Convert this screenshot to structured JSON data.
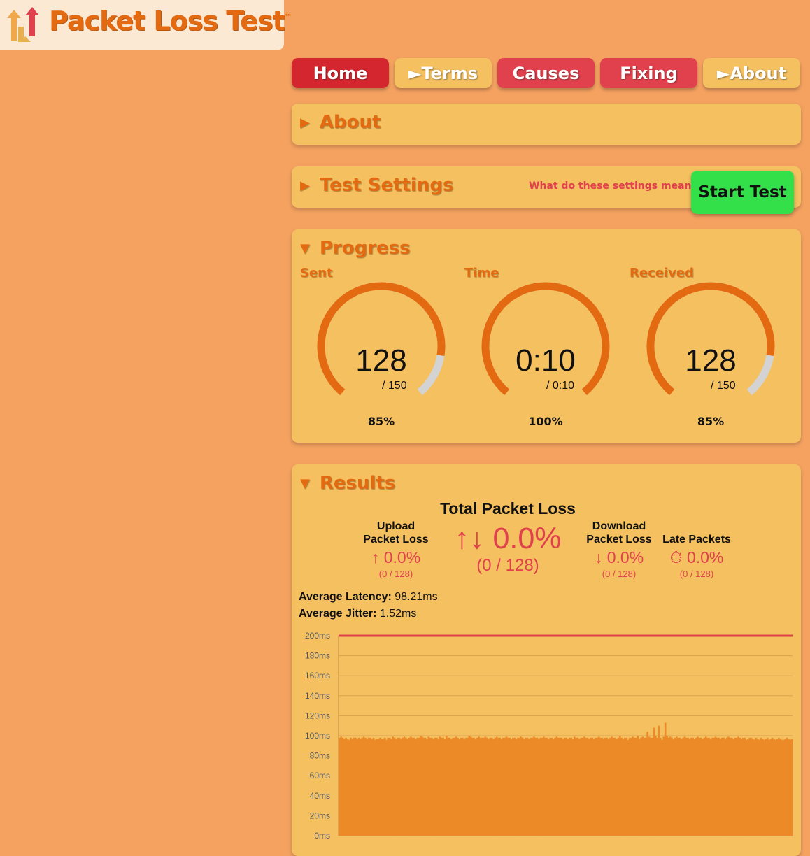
{
  "logo": {
    "title": "Packet Loss Test",
    "trademark": "™"
  },
  "nav": {
    "home": "Home",
    "terms": "►Terms",
    "causes": "Causes",
    "fixing": "Fixing",
    "about": "►About"
  },
  "about_panel": {
    "title": "About"
  },
  "settings_panel": {
    "title": "Test Settings",
    "help_link": "What do these settings mean?",
    "start_button": "Start Test"
  },
  "progress_panel": {
    "title": "Progress",
    "gauges": [
      {
        "label": "Sent",
        "value": "128",
        "total": "/ 150",
        "percent": "85%",
        "fraction": 0.853
      },
      {
        "label": "Time",
        "value": "0:10",
        "total": "/ 0:10",
        "percent": "100%",
        "fraction": 1.0
      },
      {
        "label": "Received",
        "value": "128",
        "total": "/ 150",
        "percent": "85%",
        "fraction": 0.853
      }
    ]
  },
  "results_panel": {
    "title": "Results",
    "total_title": "Total Packet Loss",
    "total_value": "↑↓ 0.0%",
    "total_sub": "(0 / 128)",
    "upload": {
      "label1": "Upload",
      "label2": "Packet Loss",
      "value": "↑ 0.0%",
      "sub": "(0 / 128)"
    },
    "download": {
      "label1": "Download",
      "label2": "Packet Loss",
      "value": "↓ 0.0%",
      "sub": "(0 / 128)"
    },
    "late": {
      "label": "Late Packets",
      "value": "⏱ 0.0%",
      "sub": "(0 / 128)"
    },
    "avg_latency_label": "Average Latency:",
    "avg_latency_value": "98.21ms",
    "avg_jitter_label": "Average Jitter:",
    "avg_jitter_value": "1.52ms"
  },
  "colors": {
    "background": "#f5a261",
    "panel": "#f4c060",
    "accent_orange": "#e46a12",
    "accent_red": "#e0414d",
    "start_green": "#34e04a",
    "gauge_track": "#d3d3d3",
    "bar_fill": "#ec8a28",
    "threshold_line": "#e0414d"
  },
  "chart_data": {
    "type": "bar",
    "ylabel": "",
    "xlabel": "",
    "ylim": [
      0,
      200
    ],
    "yticks": [
      "0ms",
      "20ms",
      "40ms",
      "60ms",
      "80ms",
      "100ms",
      "120ms",
      "140ms",
      "160ms",
      "180ms",
      "200ms"
    ],
    "threshold": 200,
    "values": [
      98,
      99,
      98,
      97,
      98,
      97,
      96,
      98,
      97,
      98,
      98,
      97,
      98,
      97,
      98,
      99,
      98,
      97,
      98,
      98,
      97,
      98,
      96,
      97,
      97,
      98,
      97,
      97,
      98,
      96,
      98,
      98,
      97,
      99,
      98,
      97,
      98,
      98,
      97,
      98,
      99,
      98,
      97,
      98,
      99,
      98,
      98,
      97,
      98,
      98,
      100,
      99,
      98,
      98,
      97,
      99,
      98,
      98,
      97,
      98,
      98,
      97,
      99,
      98,
      98,
      97,
      100,
      98,
      98,
      97,
      98,
      98,
      99,
      98,
      97,
      98,
      98,
      97,
      98,
      98,
      100,
      99,
      98,
      98,
      97,
      98,
      99,
      98,
      98,
      98,
      99,
      98,
      97,
      98,
      98,
      97,
      98,
      99,
      98,
      98,
      97,
      98,
      98,
      99,
      98,
      98,
      97,
      98,
      98,
      97,
      98,
      98,
      99,
      98,
      97,
      98,
      98,
      97,
      98,
      98,
      99,
      98,
      98,
      97,
      98,
      98,
      99,
      98,
      98,
      97,
      98,
      98,
      97,
      98,
      99,
      98,
      98,
      98,
      97,
      98,
      98,
      97,
      98,
      98,
      97,
      99,
      98,
      98,
      97,
      98,
      98,
      99,
      98,
      98,
      97,
      98,
      98,
      97,
      98,
      98,
      99,
      98,
      98,
      97,
      98,
      98,
      97,
      98,
      99,
      98,
      98,
      97,
      98,
      100,
      98,
      97,
      98,
      98,
      96,
      98,
      98,
      99,
      98,
      98,
      100,
      97,
      98,
      99,
      98,
      98,
      104,
      99,
      98,
      98,
      108,
      100,
      98,
      110,
      98,
      96,
      99,
      113,
      100,
      98,
      99,
      98,
      97,
      98,
      99,
      98,
      98,
      97,
      98,
      99,
      98,
      98,
      97,
      98,
      98,
      97,
      98,
      99,
      98,
      98,
      97,
      98,
      99,
      98,
      98,
      97,
      98,
      98,
      99,
      98,
      98,
      97,
      98,
      98,
      97,
      98,
      99,
      98,
      98,
      97,
      98,
      98,
      99,
      98,
      97,
      98,
      98,
      96,
      97,
      98,
      98,
      97,
      96,
      98,
      97,
      96,
      98,
      97,
      96,
      97,
      98,
      96,
      97,
      98,
      97,
      96,
      97,
      98,
      97,
      96,
      96,
      97,
      98,
      97,
      96,
      97
    ]
  }
}
